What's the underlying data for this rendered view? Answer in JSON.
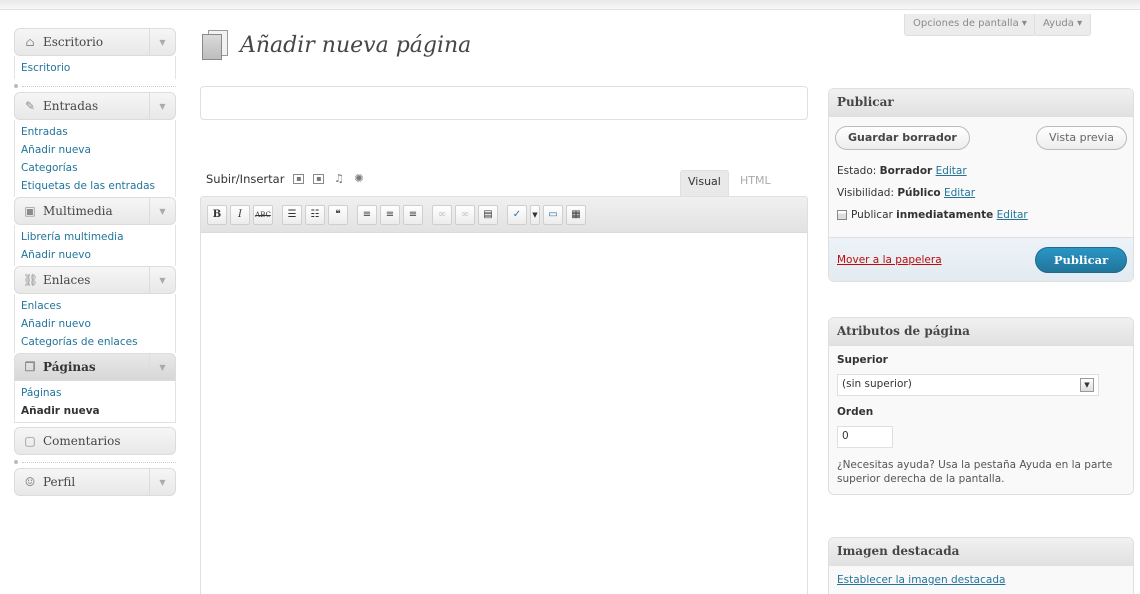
{
  "header": {
    "screen_options": "Opciones de pantalla",
    "help": "Ayuda",
    "page_title": "Añadir nueva página"
  },
  "sidebar": {
    "groups": [
      {
        "label": "Escritorio",
        "items": [
          "Escritorio"
        ]
      },
      {
        "label": "Entradas",
        "items": [
          "Entradas",
          "Añadir nueva",
          "Categorías",
          "Etiquetas de las entradas"
        ]
      },
      {
        "label": "Multimedia",
        "items": [
          "Librería multimedia",
          "Añadir nuevo"
        ]
      },
      {
        "label": "Enlaces",
        "items": [
          "Enlaces",
          "Añadir nuevo",
          "Categorías de enlaces"
        ]
      },
      {
        "label": "Páginas",
        "items": [
          "Páginas",
          "Añadir nueva"
        ]
      },
      {
        "label": "Comentarios",
        "items": []
      },
      {
        "label": "Perfil",
        "items": []
      }
    ]
  },
  "editor": {
    "upload_label": "Subir/Insertar",
    "tab_visual": "Visual",
    "tab_html": "HTML",
    "toolbar": {
      "bold": "B",
      "italic": "I",
      "strike": "ABC"
    }
  },
  "publish": {
    "title": "Publicar",
    "save_draft": "Guardar borrador",
    "preview": "Vista previa",
    "status_label": "Estado:",
    "status_value": "Borrador",
    "visibility_label": "Visibilidad:",
    "visibility_value": "Público",
    "publish_label": "Publicar",
    "publish_value": "inmediatamente",
    "edit": "Editar",
    "trash": "Mover a la papelera",
    "publish_button": "Publicar"
  },
  "attributes": {
    "title": "Atributos de página",
    "parent_label": "Superior",
    "parent_value": "(sin superior)",
    "order_label": "Orden",
    "order_value": "0",
    "help": "¿Necesitas ayuda? Usa la pestaña Ayuda en la parte superior derecha de la pantalla."
  },
  "featured": {
    "title": "Imagen destacada",
    "link": "Establecer la imagen destacada"
  }
}
